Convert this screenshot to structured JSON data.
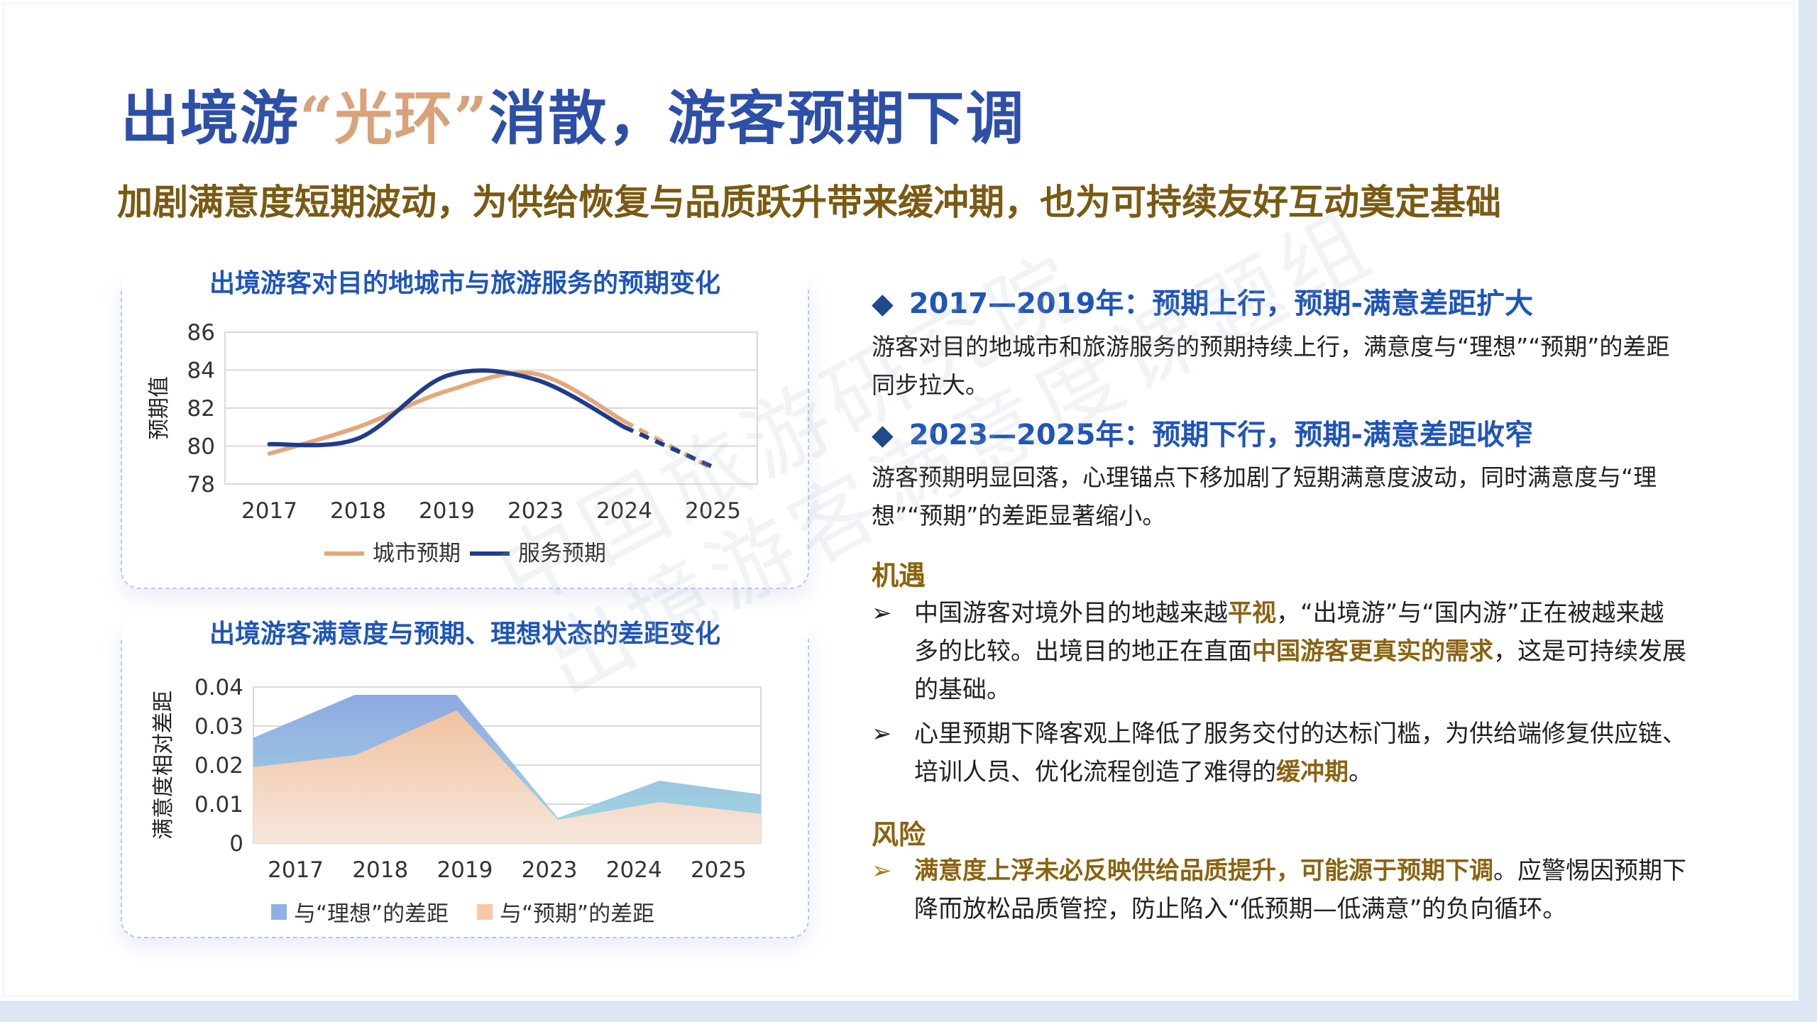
{
  "title": {
    "part1": "出境游",
    "part2": "“光环”",
    "part3": "消散，游客预期下调"
  },
  "subtitle": "加剧满意度短期波动，为供给恢复与品质跃升带来缓冲期，也为可持续友好互动奠定基础",
  "chart_data": [
    {
      "type": "line",
      "title": "出境游客对目的地城市与旅游服务的预期变化",
      "categories": [
        "2017",
        "2018",
        "2019",
        "2023",
        "2024",
        "2025"
      ],
      "ylabel": "预期值",
      "ylim": [
        78,
        86
      ],
      "yticks": [
        "86",
        "84",
        "82",
        "80",
        "78"
      ],
      "grid": true,
      "legend_position": "bottom",
      "series": [
        {
          "name": "城市预期",
          "values": [
            79.6,
            81.0,
            82.9,
            83.8,
            81.3,
            78.8
          ],
          "color": "#e3a87a"
        },
        {
          "name": "服务预期",
          "values": [
            80.1,
            80.4,
            83.7,
            83.5,
            81.0,
            78.9
          ],
          "color": "#1f3b8c"
        }
      ]
    },
    {
      "type": "area",
      "title": "出境游客满意度与预期、理想状态的差距变化",
      "categories": [
        "2017",
        "2018",
        "2019",
        "2023",
        "2024",
        "2025"
      ],
      "ylabel": "满意度相对差距",
      "ylim": [
        0,
        0.04
      ],
      "yticks": [
        "0.04",
        "0.03",
        "0.02",
        "0.01",
        "0"
      ],
      "grid": true,
      "legend_position": "bottom",
      "series": [
        {
          "name": "与“理想”的差距",
          "values": [
            0.027,
            0.038,
            0.038,
            0.0065,
            0.016,
            0.0125
          ],
          "color": "#8fa9e0"
        },
        {
          "name": "与“预期”的差距",
          "values": [
            0.0195,
            0.0225,
            0.034,
            0.006,
            0.0105,
            0.0075
          ],
          "color": "#f7c9a6"
        }
      ]
    }
  ],
  "sections": [
    {
      "heading": "2017—2019年：预期上行，预期-满意差距扩大",
      "text": "游客对目的地城市和旅游服务的预期持续上行，满意度与“理想”“预期”的差距同步拉大。"
    },
    {
      "heading": "2023—2025年：预期下行，预期-满意差距收窄",
      "text": "游客预期明显回落，心理锚点下移加剧了短期满意度波动，同时满意度与“理想”“预期”的差距显著缩小。"
    }
  ],
  "bullet_marker": "◆",
  "arrow_marker": "➢",
  "opportunity": {
    "label": "机遇",
    "b1": {
      "a": "中国游客对境外目的地越来越",
      "h1": "平视",
      "b": "，“出境游”与“国内游”正在被越来越多的比较。出境目的地正在直面",
      "h2": "中国游客更真实的需求",
      "c": "，这是可持续发展的基础。"
    },
    "b2": {
      "a": "心里预期下降客观上降低了服务交付的达标门槛，为供给端修复供应链、培训人员、优化流程创造了难得的",
      "h": "缓冲期",
      "b": "。"
    }
  },
  "risk": {
    "label": "风险",
    "b1": {
      "h": "满意度上浮未必反映供给品质提升，可能源于预期下调",
      "a": "。应警惕因预期下降而放松品质管控，防止陷入“低预期—低满意”的负向循环。"
    }
  },
  "watermark": {
    "line1": "中国旅游研究院",
    "line2": "出境游客满意度课题组"
  }
}
